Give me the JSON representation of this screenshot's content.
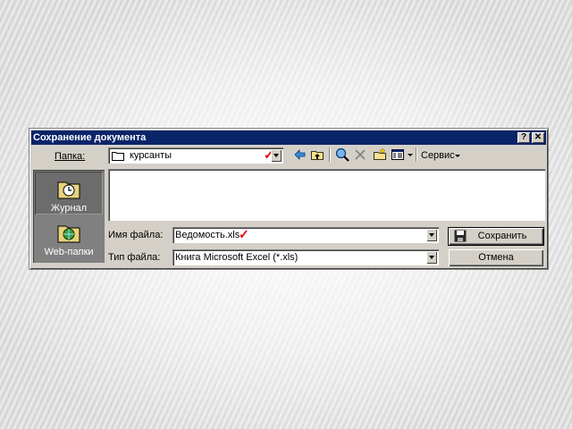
{
  "dialog": {
    "title": "Сохранение документа",
    "help_btn": "?",
    "close_btn": "✕"
  },
  "toolbar": {
    "folder_label": "Папка:",
    "folder_value": "курсанты",
    "service_label": "Сервис"
  },
  "places": [
    {
      "label": "Журнал"
    },
    {
      "label": "Web-папки"
    }
  ],
  "filename": {
    "label": "Имя файла:",
    "value": "Ведомость.xls"
  },
  "filetype": {
    "label": "Тип файла:",
    "value": "Книга Microsoft Excel (*.xls)"
  },
  "buttons": {
    "save": "Сохранить",
    "cancel": "Отмена"
  },
  "colors": {
    "titlebar": "#0a246a",
    "annotation_check": "#e00000"
  }
}
